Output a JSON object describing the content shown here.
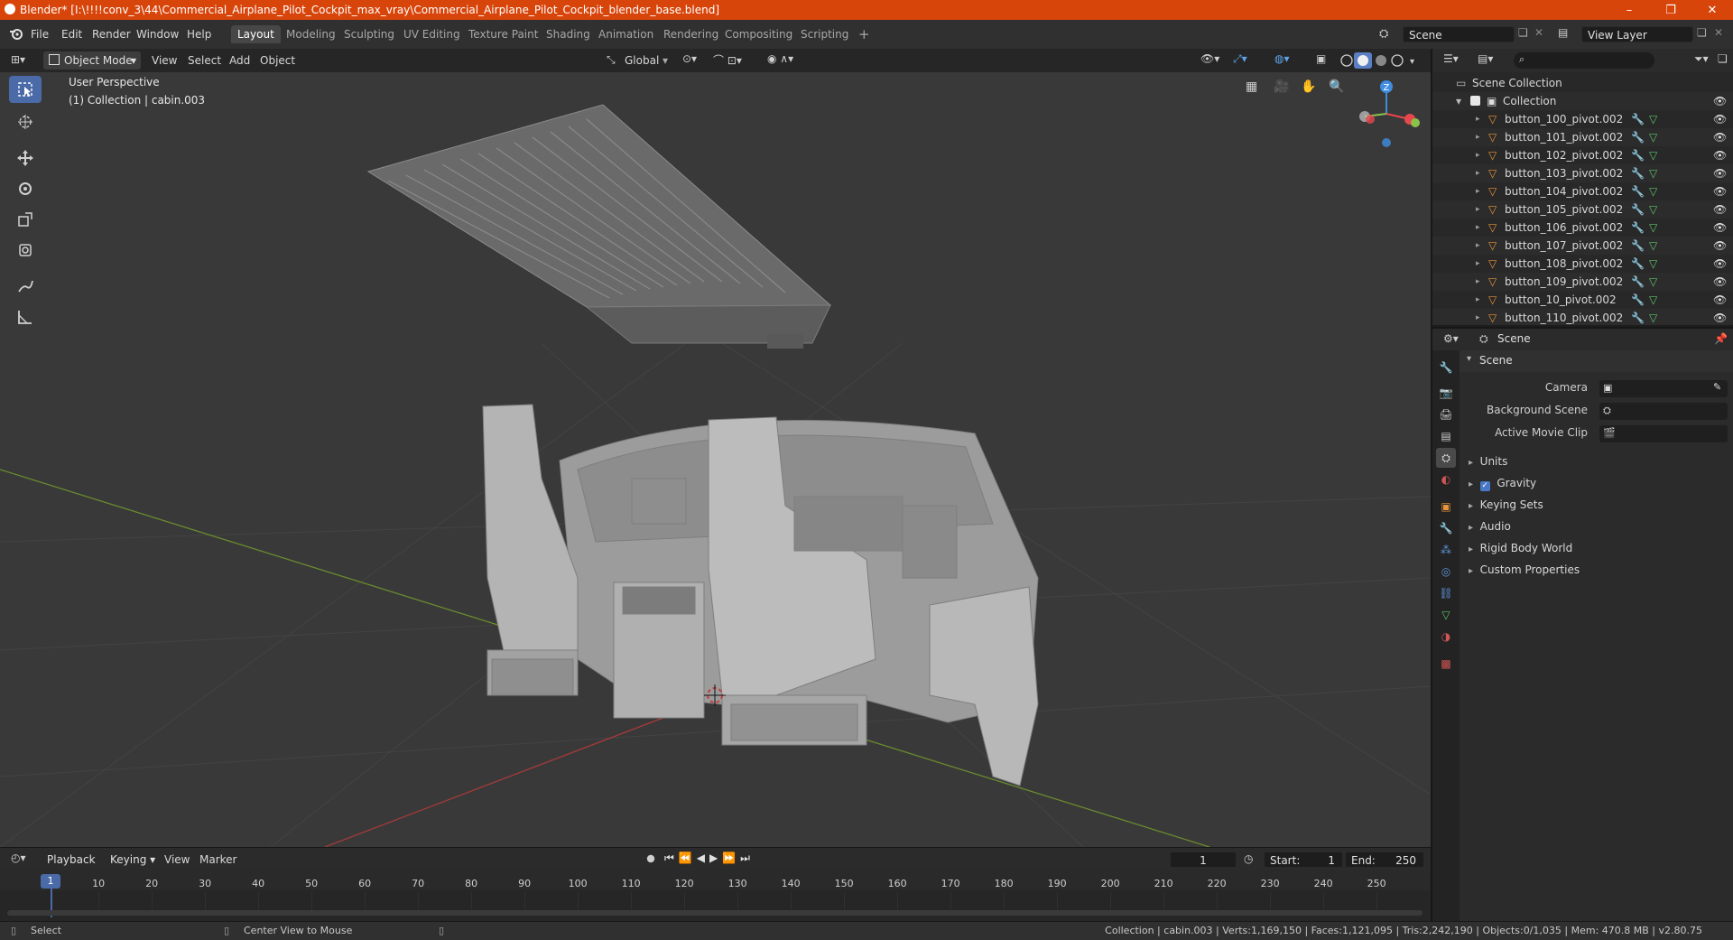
{
  "window": {
    "title": "Blender* [I:\\!!!!conv_3\\44\\Commercial_Airplane_Pilot_Cockpit_max_vray\\Commercial_Airplane_Pilot_Cockpit_blender_base.blend]",
    "minimize": "–",
    "maximize": "❐",
    "close": "✕"
  },
  "menubar": {
    "menus": [
      "File",
      "Edit",
      "Render",
      "Window",
      "Help"
    ],
    "workspaces": [
      "Layout",
      "Modeling",
      "Sculpting",
      "UV Editing",
      "Texture Paint",
      "Shading",
      "Animation",
      "Rendering",
      "Compositing",
      "Scripting"
    ],
    "active_workspace": "Layout",
    "add_workspace": "+",
    "scene_name": "Scene",
    "view_layer": "View Layer"
  },
  "viewport_header": {
    "mode": "Object Mode",
    "menus": [
      "View",
      "Select",
      "Add",
      "Object"
    ],
    "transform_orientation": "Global"
  },
  "viewport": {
    "overlay_line1": "User Perspective",
    "overlay_line2": "(1) Collection | cabin.003",
    "gizmo_axis": "Z",
    "colors": {
      "x_axis": "#e8474f",
      "y_axis": "#8bc34a",
      "z_axis": "#3f8de0",
      "grid": "#444444",
      "background": "#393939"
    }
  },
  "timeline": {
    "menus": [
      "Playback",
      "Keying",
      "View",
      "Marker"
    ],
    "current_frame": "1",
    "start_label": "Start:",
    "start": "1",
    "end_label": "End:",
    "end": "250",
    "frame_marker": "1",
    "ticks": [
      "10",
      "20",
      "30",
      "40",
      "50",
      "60",
      "70",
      "80",
      "90",
      "100",
      "110",
      "120",
      "130",
      "140",
      "150",
      "160",
      "170",
      "180",
      "190",
      "200",
      "210",
      "220",
      "230",
      "240",
      "250"
    ]
  },
  "statusbar": {
    "select": "Select",
    "center_view": "Center View to Mouse",
    "stats": "Collection | cabin.003 | Verts:1,169,150 | Faces:1,121,095 | Tris:2,242,190 | Objects:0/1,035 | Mem: 470.8 MB | v2.80.75"
  },
  "outliner": {
    "root": "Scene Collection",
    "collection": "Collection",
    "items": [
      "button_100_pivot.002",
      "button_101_pivot.002",
      "button_102_pivot.002",
      "button_103_pivot.002",
      "button_104_pivot.002",
      "button_105_pivot.002",
      "button_106_pivot.002",
      "button_107_pivot.002",
      "button_108_pivot.002",
      "button_109_pivot.002",
      "button_10_pivot.002",
      "button_110_pivot.002"
    ]
  },
  "properties": {
    "header_title": "Scene",
    "panel_title": "Scene",
    "fields": [
      {
        "label": "Camera",
        "value": ""
      },
      {
        "label": "Background Scene",
        "value": ""
      },
      {
        "label": "Active Movie Clip",
        "value": ""
      }
    ],
    "subpanels": [
      "Units",
      "Gravity",
      "Keying Sets",
      "Audio",
      "Rigid Body World",
      "Custom Properties"
    ],
    "gravity_checked": true
  }
}
